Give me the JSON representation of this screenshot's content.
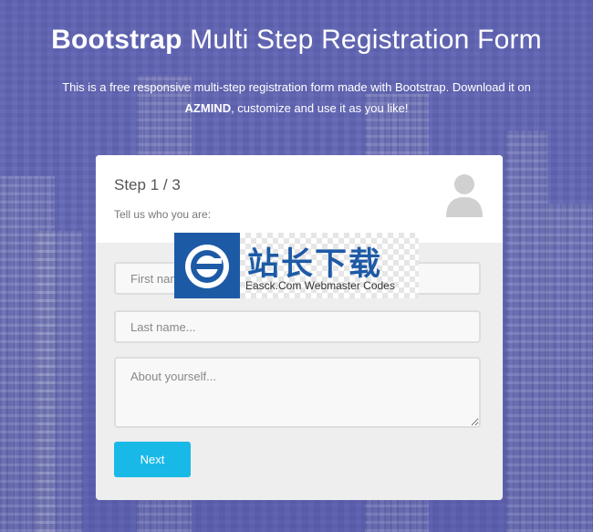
{
  "header": {
    "title_bold": "Bootstrap",
    "title_light": "Multi Step Registration Form",
    "subtitle_before": "This is a free responsive multi-step registration form made with Bootstrap. Download it on",
    "subtitle_brand": "AZMIND",
    "subtitle_after": ", customize and use it as you like!"
  },
  "form": {
    "step_title": "Step 1 / 3",
    "step_description": "Tell us who you are:",
    "icon": "user-icon",
    "first_name_placeholder": "First name...",
    "last_name_placeholder": "Last name...",
    "about_placeholder": "About yourself...",
    "next_label": "Next"
  },
  "watermark": {
    "cn": "站长下载",
    "en": "Easck.Com Webmaster Codes"
  },
  "colors": {
    "background": "#6367b3",
    "button": "#19b9e7",
    "watermark_blue": "#1d5aa6"
  }
}
